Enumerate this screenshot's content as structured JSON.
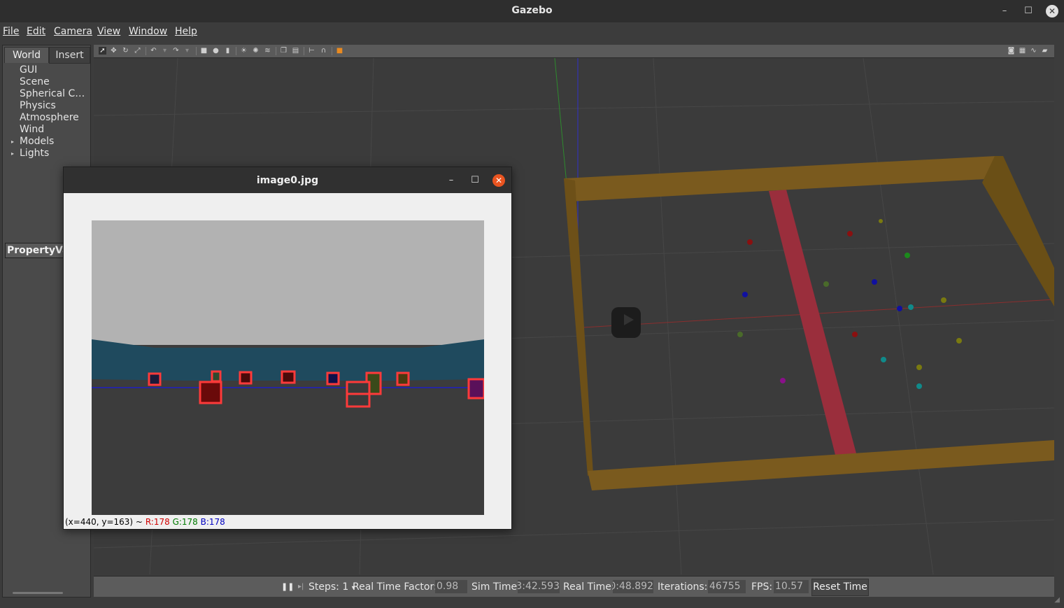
{
  "window": {
    "title": "Gazebo",
    "minimize": "–",
    "maximize": "☐",
    "close": "✕"
  },
  "menu": [
    "File",
    "Edit",
    "Camera",
    "View",
    "Window",
    "Help"
  ],
  "left_panel": {
    "tabs": [
      "World",
      "Insert"
    ],
    "tree": [
      "GUI",
      "Scene",
      "Spherical Co…",
      "Physics",
      "Atmosphere",
      "Wind",
      "Models",
      "Lights"
    ],
    "property_header": "PropertyValu"
  },
  "image_window": {
    "title": "image0.jpg",
    "status_prefix": "(x=440, y=163) ~",
    "r": "R:178",
    "g": "G:178",
    "b": "B:178",
    "minimize": "–",
    "maximize": "☐",
    "close": "✕"
  },
  "bottom_bar": {
    "steps_label": "Steps: 1",
    "rtf_label": "Real Time Factor:",
    "rtf_value": "0.98",
    "sim_label": "Sim Time:",
    "sim_value": "3:42.593",
    "real_label": "Real Time:",
    "real_value": "0:48.892",
    "iter_label": "Iterations:",
    "iter_value": "46755",
    "fps_label": "FPS:",
    "fps_value": "10.57",
    "reset_label": "Reset Time"
  },
  "colors": {
    "arena_wall": "#7a5a1e",
    "stripe": "#a8303e",
    "accent": "#e95420",
    "detection_box": "#ff3a3a"
  }
}
